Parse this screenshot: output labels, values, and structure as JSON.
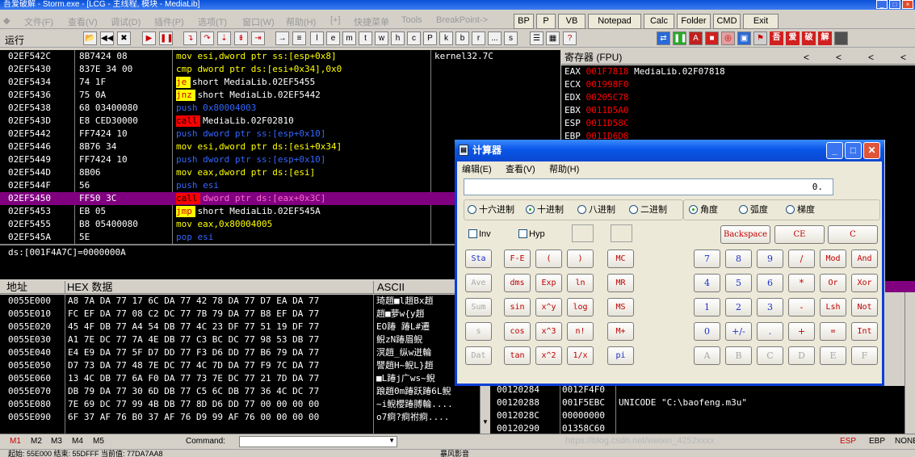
{
  "window": {
    "title": "吾爱破解 - Storm.exe - [LCG - 主线程, 模块 - MediaLib]"
  },
  "menu": [
    "文件(F)",
    "查看(V)",
    "调试(D)",
    "插件(P)",
    "选项(T)",
    "窗口(W)",
    "帮助(H)",
    "[+]",
    "快捷菜单",
    "Tools",
    "BreakPoint->"
  ],
  "quick_buttons": [
    "BP",
    "P",
    "VB",
    "Notepad",
    "Calc",
    "Folder",
    "CMD",
    "Exit"
  ],
  "toolbar": {
    "status": "运行",
    "letters": [
      "l",
      "e",
      "m",
      "t",
      "w",
      "h",
      "c",
      "P",
      "k",
      "b",
      "r",
      "...",
      "s"
    ],
    "plugin_letters": [
      "吾",
      "爱",
      "破",
      "解"
    ]
  },
  "disasm": {
    "rows": [
      {
        "addr": "02EF542C",
        "hex": "8B7424 08",
        "asm": "mov esi,dword ptr ss:[esp+0x8]"
      },
      {
        "addr": "02EF5430",
        "hex": "837E 34 00",
        "asm": "cmp dword ptr ds:[esi+0x34],0x0"
      },
      {
        "addr": "02EF5434",
        "hex": "74 1F",
        "asm": "je short MediaLib.02EF5455"
      },
      {
        "addr": "02EF5436",
        "hex": "75 0A",
        "asm": "jnz short MediaLib.02EF5442"
      },
      {
        "addr": "02EF5438",
        "hex": "68 03400080",
        "asm": "push 0x80004003"
      },
      {
        "addr": "02EF543D",
        "hex": "E8 CED30000",
        "asm": "call MediaLib.02F02810"
      },
      {
        "addr": "02EF5442",
        "hex": "FF7424 10",
        "asm": "push dword ptr ss:[esp+0x10]"
      },
      {
        "addr": "02EF5446",
        "hex": "8B76 34",
        "asm": "mov esi,dword ptr ds:[esi+0x34]"
      },
      {
        "addr": "02EF5449",
        "hex": "FF7424 10",
        "asm": "push dword ptr ss:[esp+0x10]"
      },
      {
        "addr": "02EF544D",
        "hex": "8B06",
        "asm": "mov eax,dword ptr ds:[esi]"
      },
      {
        "addr": "02EF544F",
        "hex": "56",
        "asm": "push esi"
      },
      {
        "addr": "02EF5450",
        "hex": "FF50 3C",
        "asm": "call dword ptr ds:[eax+0x3C]"
      },
      {
        "addr": "02EF5453",
        "hex": "EB 05",
        "asm": "jmp short MediaLib.02EF545A"
      },
      {
        "addr": "02EF5455",
        "hex": "B8 05400080",
        "asm": "mov eax,0x80004005"
      },
      {
        "addr": "02EF545A",
        "hex": "5E",
        "asm": "pop esi"
      }
    ],
    "comment": "kernel32.7C",
    "info": "ds:[001F4A7C]=0000000A"
  },
  "registers": {
    "title": "寄存器 (FPU)",
    "rows": [
      {
        "name": "EAX",
        "value": "001F7818",
        "note": "MediaLib.02F07818"
      },
      {
        "name": "ECX",
        "value": "001998F0",
        "note": ""
      },
      {
        "name": "EDX",
        "value": "00205C78",
        "note": ""
      },
      {
        "name": "EBX",
        "value": "0011D5A0",
        "note": ""
      },
      {
        "name": "ESP",
        "value": "0011D58C",
        "note": ""
      },
      {
        "name": "EBP",
        "value": "0011D6D8",
        "note": ""
      }
    ]
  },
  "hexdump": {
    "headers": {
      "addr": "地址",
      "hex": "HEX 数据",
      "ascii": "ASCII"
    },
    "rows": [
      {
        "addr": "0055E000",
        "hex": "A8 7A DA 77 17 6C DA 77 42 78 DA 77 D7 EA DA 77",
        "ascii": "琦趙■l趙Bx趙"
      },
      {
        "addr": "0055E010",
        "hex": "FC EF DA 77 08 C2 DC 77 7B 79 DA 77 B8 EF DA 77",
        "ascii": "  趙■萝w{y趙"
      },
      {
        "addr": "0055E020",
        "hex": "45 4F DB 77 A4 54 DB 77 4C 23 DF 77 51 19 DF 77",
        "ascii": "EO踳  踳L#遷"
      },
      {
        "addr": "0055E030",
        "hex": "A1 7E DC 77 7A 4E DB 77 C3 BC DC 77 98 53 DB 77",
        "ascii": "  鲵zN踳眉鲵"
      },
      {
        "addr": "0055E040",
        "hex": "E4 E9 DA 77 5F D7 DD 77 F3 D6 DD 77 B6 79 DA 77",
        "ascii": "溟趙_纵w迸輪"
      },
      {
        "addr": "0055E050",
        "hex": "D7 73 DA 77 48 7E DC 77 4C 7D DA 77 F9 7C DA 77",
        "ascii": "譻趙H~鲵L}趙"
      },
      {
        "addr": "0055E060",
        "hex": "13 4C DB 77 6A F0 DA 77 73 7E DC 77 21 7D DA 77",
        "ascii": "■L踳j广ws~鲵"
      },
      {
        "addr": "0055E070",
        "hex": "DB 79 DA 77 30 6D DB 77 C5 6C DB 77 36 4C DC 77",
        "ascii": "踉趙0m踳跃踳6L鲵"
      },
      {
        "addr": "0055E080",
        "hex": "7E 69 DC 77 99 4B DB 77 8D D6 DD 77 00 00 00 00",
        "ascii": "~i鲵櫻踳膊輪...."
      },
      {
        "addr": "0055E090",
        "hex": "6F 37 AF 76 B0 37 AF 76 D9 99 AF 76 00 00 00 00",
        "ascii": "o7痾?痾祔痾...."
      }
    ]
  },
  "stack": {
    "rows": [
      {
        "addr": "00120284",
        "value": "0012F4F0",
        "comment": ""
      },
      {
        "addr": "00120288",
        "value": "001F5EBC",
        "comment": "UNICODE \"C:\\baofeng.m3u\""
      },
      {
        "addr": "0012028C",
        "value": "00000000",
        "comment": ""
      },
      {
        "addr": "00120290",
        "value": "01358C60",
        "comment": ""
      }
    ]
  },
  "bottombar": {
    "tabs": [
      "M1",
      "M2",
      "M3",
      "M4",
      "M5"
    ],
    "command_label": "Command:",
    "esp": "ESP",
    "ebp": "EBP",
    "none": "NONE"
  },
  "statusbar": {
    "text": "起始: 55E000 结束: 55DFFF 当前值: 77DA7AA8",
    "middle": "暴风影音",
    "watermark": "https://blog.csdn.net/weixin_4252xxxx"
  },
  "calculator": {
    "title": "计算器",
    "menu": [
      "编辑(E)",
      "查看(V)",
      "帮助(H)"
    ],
    "display": "0.",
    "bases": [
      "十六进制",
      "十进制",
      "八进制",
      "二进制"
    ],
    "angles": [
      "角度",
      "弧度",
      "梯度"
    ],
    "checks": [
      "Inv",
      "Hyp"
    ],
    "top_keys": [
      "Backspace",
      "CE",
      "C"
    ],
    "stat_keys": [
      "Sta",
      "Ave",
      "Sum",
      "s",
      "Dat"
    ],
    "sci_keys": [
      "F-E",
      "(",
      ")",
      "dms",
      "Exp",
      "ln",
      "sin",
      "x^y",
      "log",
      "cos",
      "x^3",
      "n!",
      "tan",
      "x^2",
      "1/x"
    ],
    "mem_keys": [
      "MC",
      "MR",
      "MS",
      "M+",
      "pi"
    ],
    "num_keys": [
      "7",
      "8",
      "9",
      "/",
      "Mod",
      "And",
      "4",
      "5",
      "6",
      "*",
      "Or",
      "Xor",
      "1",
      "2",
      "3",
      "-",
      "Lsh",
      "Not",
      "0",
      "+/-",
      ".",
      "+",
      "=",
      "Int",
      "A",
      "B",
      "C",
      "D",
      "E",
      "F"
    ]
  },
  "colors": {
    "je_bg": "#ffff00",
    "call_bg": "#ff0000",
    "push": "#0000ff",
    "mov": "#ffff00",
    "highlight": "#800080",
    "reg_value": "#ff0000"
  }
}
